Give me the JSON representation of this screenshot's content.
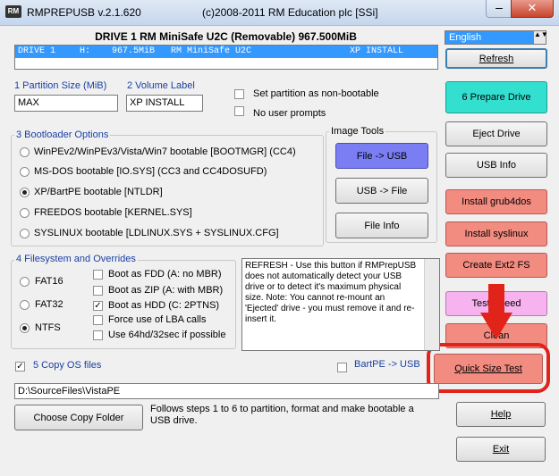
{
  "window": {
    "app_icon": "RM",
    "title": "RMPREPUSB v.2.1.620",
    "copyright": "(c)2008-2011 RM Education plc [SSi]",
    "minimize": "–",
    "close": "✕"
  },
  "drive": {
    "title": "DRIVE 1 RM MiniSafe U2C  (Removable) 967.500MiB",
    "row": {
      "drive": "DRIVE 1",
      "letter": "H:",
      "size": "967.5MiB",
      "name": "RM MiniSafe U2C",
      "status": "XP INSTALL"
    }
  },
  "language": {
    "selected": "English",
    "arrow": "▲▼"
  },
  "partition": {
    "size_label": "1 Partition Size (MiB)",
    "size_value": "MAX",
    "volume_label": "2 Volume Label",
    "volume_value": "XP INSTALL",
    "non_bootable_label": "Set partition as non-bootable",
    "no_prompts_label": "No user prompts"
  },
  "bootloader": {
    "title": "3 Bootloader Options",
    "options": [
      "WinPEv2/WinPEv3/Vista/Win7 bootable [BOOTMGR] (CC4)",
      "MS-DOS bootable [IO.SYS]   (CC3 and CC4DOSUFD)",
      "XP/BartPE bootable [NTLDR]",
      "FREEDOS bootable [KERNEL.SYS]",
      "SYSLINUX bootable [LDLINUX.SYS + SYSLINUX.CFG]"
    ],
    "selected_index": 2
  },
  "image_tools": {
    "title": "Image Tools",
    "file_to_usb": "File -> USB",
    "usb_to_file": "USB -> File",
    "file_info": "File Info"
  },
  "filesystem": {
    "title": "4 Filesystem and Overrides",
    "types": [
      "FAT16",
      "FAT32",
      "NTFS"
    ],
    "selected": "NTFS",
    "overrides": [
      {
        "label": "Boot as FDD (A: no MBR)",
        "checked": false
      },
      {
        "label": "Boot as ZIP (A: with MBR)",
        "checked": false
      },
      {
        "label": "Boot as HDD (C: 2PTNS)",
        "checked": true
      },
      {
        "label": "Force use of LBA calls",
        "checked": false
      },
      {
        "label": "Use 64hd/32sec if possible",
        "checked": false
      }
    ]
  },
  "info_text": "REFRESH - Use this button if RMPrepUSB does not automatically detect your USB drive or to detect it's maximum physical size. Note: You cannot re-mount an 'Ejected' drive - you must remove it and re-insert it.",
  "copy_os": {
    "label": "5 Copy OS files",
    "checked": true,
    "bartpe_label": "BartPE -> USB",
    "bartpe_checked": false,
    "path": "D:\\SourceFiles\\VistaPE",
    "choose_button": "Choose Copy Folder",
    "footer": "Follows steps 1 to 6 to partition, format and make bootable a USB drive."
  },
  "right_buttons": {
    "refresh": "Refresh",
    "prepare": "6 Prepare Drive",
    "eject": "Eject Drive",
    "usb_info": "USB Info",
    "grub4dos": "Install grub4dos",
    "syslinux": "Install syslinux",
    "ext2": "Create Ext2 FS",
    "test_speed": "Test Speed",
    "clean": "Clean",
    "quick_size": "Quick Size Test",
    "help": "Help",
    "exit": "Exit"
  },
  "colors": {
    "accent_blue": "#3399ff",
    "prepare_bg": "#33e0d0",
    "file_usb_bg": "#7a7ef2",
    "salmon": "#f28b80",
    "pink": "#f7b3f0",
    "highlight_red": "#e2231a"
  }
}
